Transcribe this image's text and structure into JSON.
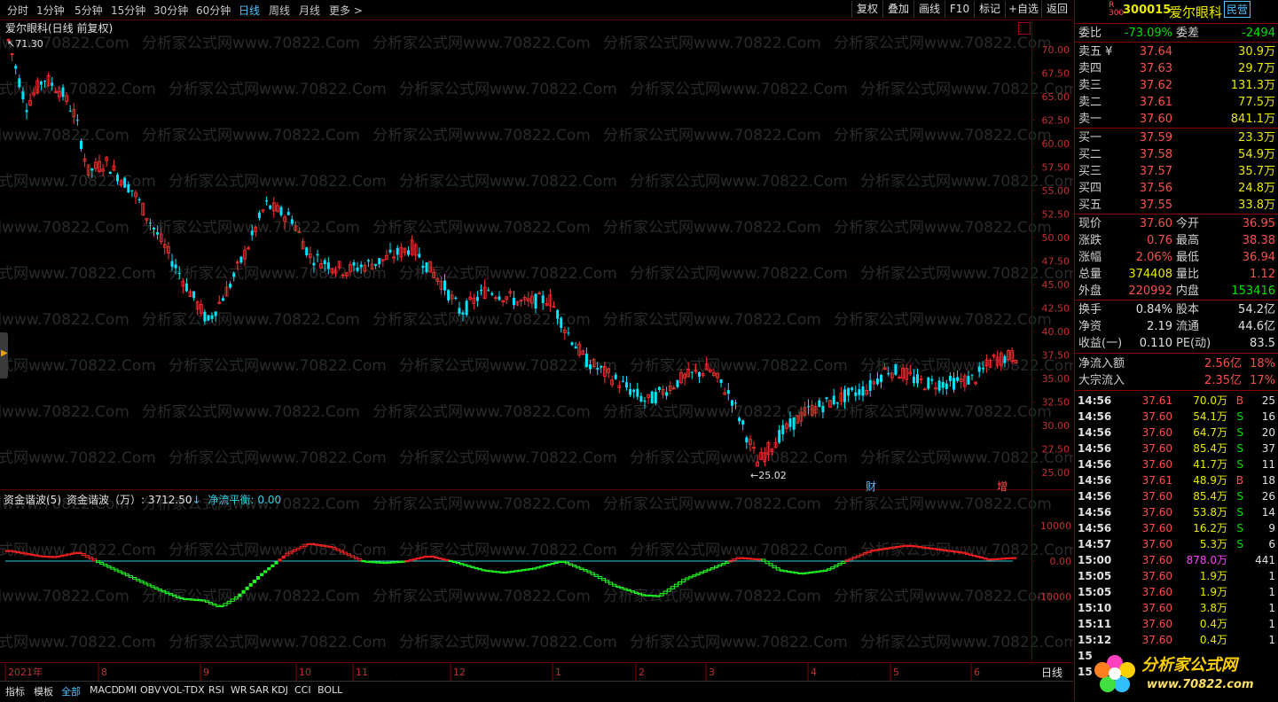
{
  "topbar": {
    "tabs": [
      "分时",
      "1分钟",
      "5分钟",
      "15分钟",
      "30分钟",
      "60分钟",
      "日线",
      "周线",
      "月线",
      "更多 >"
    ],
    "active_tab": "日线",
    "tools": [
      "复权",
      "叠加",
      "画线",
      "F10",
      "标记",
      "+自选",
      "返回"
    ]
  },
  "chart": {
    "title": "爱尔眼科(日线 前复权)",
    "high_label": "71.30",
    "low_label": "25.02",
    "price_axis": [
      "70.00",
      "67.50",
      "65.00",
      "62.50",
      "60.00",
      "57.50",
      "55.00",
      "52.50",
      "50.00",
      "47.50",
      "45.00",
      "42.50",
      "40.00",
      "37.50",
      "35.00",
      "32.50",
      "30.00",
      "27.50",
      "25.00"
    ],
    "markers": [
      "财",
      "增"
    ],
    "watermark": "分析家公式网www.70822.Com",
    "indicator_title": "资金谐波(5)",
    "indicator_value_label": "资金谐波（万）: 3712.50",
    "indicator_arrow": "↓",
    "indicator_balance": "净流平衡: 0.00",
    "indicator_axis": [
      "10000",
      "0.00",
      "-10000"
    ],
    "months": [
      "2021年",
      "8",
      "9",
      "10",
      "11",
      "12",
      "1",
      "2",
      "3",
      "4",
      "5",
      "6"
    ],
    "period_label": "日线",
    "zoom_controls": [
      "+",
      "-",
      "○"
    ]
  },
  "bottombar": {
    "tabs": [
      "指标",
      "模板",
      "全部",
      "MACD",
      "DMI",
      "OBV",
      "VOL-TDX",
      "RSI",
      "WR",
      "SAR",
      "KDJ",
      "CCI",
      "BOLL"
    ],
    "active_tab": "全部"
  },
  "quote": {
    "market_badge": "R",
    "market_badge2": "300",
    "code": "300015",
    "name": "爱尔眼科",
    "tag": "民营",
    "weibi_label": "委比",
    "weibi": "-73.09%",
    "weicha_label": "委差",
    "weicha": "-2494",
    "asks": [
      {
        "label": "卖五 ¥",
        "price": "37.64",
        "vol": "30.9万"
      },
      {
        "label": "卖四",
        "price": "37.63",
        "vol": "29.7万"
      },
      {
        "label": "卖三",
        "price": "37.62",
        "vol": "131.3万"
      },
      {
        "label": "卖二",
        "price": "37.61",
        "vol": "77.5万"
      },
      {
        "label": "卖一",
        "price": "37.60",
        "vol": "841.1万"
      }
    ],
    "bids": [
      {
        "label": "买一",
        "price": "37.59",
        "vol": "23.3万"
      },
      {
        "label": "买二",
        "price": "37.58",
        "vol": "54.9万"
      },
      {
        "label": "买三",
        "price": "37.57",
        "vol": "35.7万"
      },
      {
        "label": "买四",
        "price": "37.56",
        "vol": "24.8万"
      },
      {
        "label": "买五",
        "price": "37.55",
        "vol": "33.8万"
      }
    ],
    "stats": [
      {
        "l1": "现价",
        "v1": "37.60",
        "c1": "red",
        "l2": "今开",
        "v2": "36.95",
        "c2": "red"
      },
      {
        "l1": "涨跌",
        "v1": "0.76",
        "c1": "red",
        "l2": "最高",
        "v2": "38.38",
        "c2": "red"
      },
      {
        "l1": "涨幅",
        "v1": "2.06%",
        "c1": "red",
        "l2": "最低",
        "v2": "36.94",
        "c2": "red"
      },
      {
        "l1": "总量",
        "v1": "374408",
        "c1": "yellow",
        "l2": "量比",
        "v2": "1.12",
        "c2": "red"
      },
      {
        "l1": "外盘",
        "v1": "220992",
        "c1": "red",
        "l2": "内盘",
        "v2": "153416",
        "c2": "green"
      }
    ],
    "stats2": [
      {
        "l1": "换手",
        "v1": "0.84%",
        "l2": "股本",
        "v2": "54.2亿"
      },
      {
        "l1": "净资",
        "v1": "2.19",
        "l2": "流通",
        "v2": "44.6亿"
      },
      {
        "l1": "收益(一)",
        "v1": "0.110",
        "l2": "PE(动)",
        "v2": "83.5"
      }
    ],
    "flows": [
      {
        "label": "净流入额",
        "value": "2.56亿",
        "pct": "18%"
      },
      {
        "label": "大宗流入",
        "value": "2.35亿",
        "pct": "17%"
      }
    ],
    "ticks": [
      {
        "t": "14:56",
        "p": "37.61",
        "v": "70.0万",
        "bs": "B",
        "n": "25"
      },
      {
        "t": "14:56",
        "p": "37.60",
        "v": "54.1万",
        "bs": "S",
        "n": "16"
      },
      {
        "t": "14:56",
        "p": "37.60",
        "v": "64.7万",
        "bs": "S",
        "n": "20"
      },
      {
        "t": "14:56",
        "p": "37.60",
        "v": "85.4万",
        "bs": "S",
        "n": "37"
      },
      {
        "t": "14:56",
        "p": "37.60",
        "v": "41.7万",
        "bs": "S",
        "n": "11"
      },
      {
        "t": "14:56",
        "p": "37.61",
        "v": "48.9万",
        "bs": "B",
        "n": "18"
      },
      {
        "t": "14:56",
        "p": "37.60",
        "v": "85.4万",
        "bs": "S",
        "n": "26"
      },
      {
        "t": "14:56",
        "p": "37.60",
        "v": "53.8万",
        "bs": "S",
        "n": "14"
      },
      {
        "t": "14:56",
        "p": "37.60",
        "v": "16.2万",
        "bs": "S",
        "n": "9"
      },
      {
        "t": "14:57",
        "p": "37.60",
        "v": "5.3万",
        "bs": "S",
        "n": "6"
      },
      {
        "t": "15:00",
        "p": "37.60",
        "v": "878.0万",
        "bs": "",
        "n": "441"
      },
      {
        "t": "15:05",
        "p": "37.60",
        "v": "1.9万",
        "bs": "",
        "n": "1"
      },
      {
        "t": "15:05",
        "p": "37.60",
        "v": "1.9万",
        "bs": "",
        "n": "1"
      },
      {
        "t": "15:10",
        "p": "37.60",
        "v": "3.8万",
        "bs": "",
        "n": "1"
      },
      {
        "t": "15:11",
        "p": "37.60",
        "v": "0.4万",
        "bs": "",
        "n": "1"
      },
      {
        "t": "15:12",
        "p": "37.60",
        "v": "0.4万",
        "bs": "",
        "n": "1"
      },
      {
        "t": "15",
        "p": "",
        "v": "",
        "bs": "",
        "n": ""
      },
      {
        "t": "15",
        "p": "",
        "v": "",
        "bs": "",
        "n": ""
      }
    ],
    "logo_text": "分析家公式网",
    "logo_url": "www.70822.com"
  },
  "colors": {
    "up": "#ff3030",
    "down": "#00e5ff",
    "wave_up": "#ff2020",
    "wave_down": "#20ff20",
    "zero": "#30d0e0",
    "grid": "#5a0000"
  }
}
